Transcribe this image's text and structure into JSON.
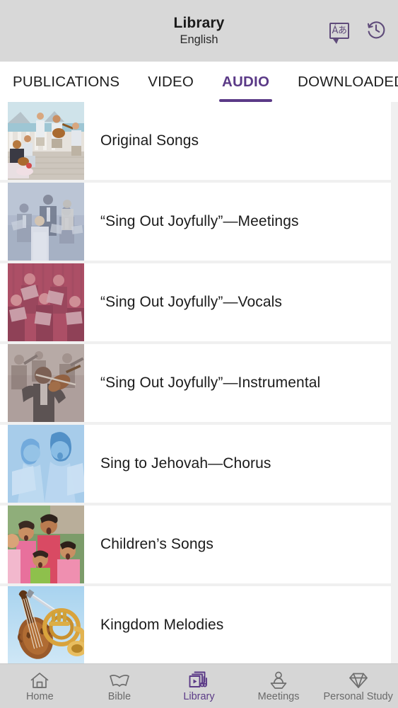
{
  "header": {
    "title": "Library",
    "subtitle": "English",
    "actions": [
      {
        "name": "language-icon",
        "glyph": "Áあ",
        "label": "Language"
      },
      {
        "name": "history-icon",
        "glyph": "history",
        "label": "History"
      }
    ]
  },
  "tabs": [
    {
      "label": "PUBLICATIONS",
      "active": false
    },
    {
      "label": "VIDEO",
      "active": false
    },
    {
      "label": "AUDIO",
      "active": true
    },
    {
      "label": "DOWNLOADED",
      "active": false
    }
  ],
  "list": [
    {
      "title": "Original Songs",
      "thumb": "beach-musicians"
    },
    {
      "title": "“Sing Out Joyfully”—Meetings",
      "thumb": "congregation-singing"
    },
    {
      "title": "“Sing Out Joyfully”—Vocals",
      "thumb": "choir-rose"
    },
    {
      "title": "“Sing Out Joyfully”—Instrumental",
      "thumb": "violinist-orchestra"
    },
    {
      "title": "Sing to Jehovah—Chorus",
      "thumb": "singers-blue"
    },
    {
      "title": "Children’s Songs",
      "thumb": "children-singing"
    },
    {
      "title": "Kingdom Melodies",
      "thumb": "violin-horn"
    }
  ],
  "bottom_nav": [
    {
      "label": "Home",
      "icon": "home-icon",
      "active": false
    },
    {
      "label": "Bible",
      "icon": "book-icon",
      "active": false
    },
    {
      "label": "Library",
      "icon": "media-library-icon",
      "active": true
    },
    {
      "label": "Meetings",
      "icon": "podium-icon",
      "active": false
    },
    {
      "label": "Personal Study",
      "icon": "gem-icon",
      "active": false
    }
  ],
  "colors": {
    "accent": "#5b3a87",
    "header_bg": "#d8d8d8",
    "nav_bg": "#d6d6d6",
    "page_bg": "#f0f0f0",
    "row_bg": "#ffffff",
    "text": "#1b1b1b",
    "nav_inactive": "#6a6a6a"
  }
}
